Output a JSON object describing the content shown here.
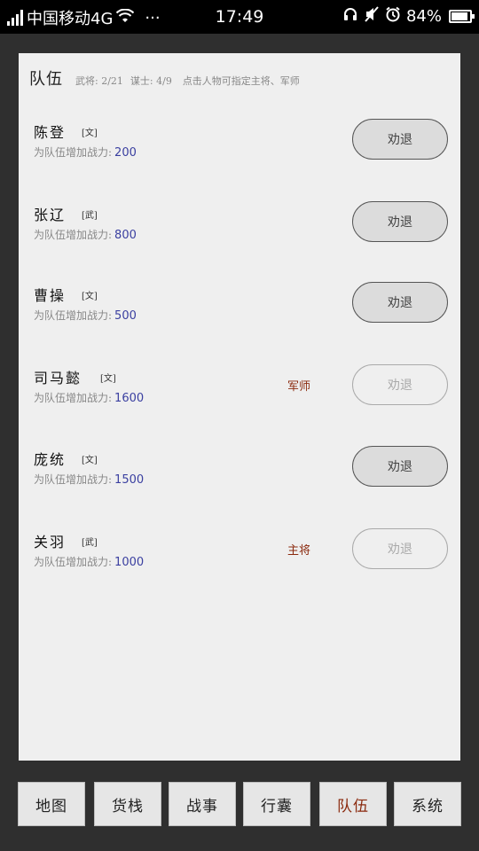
{
  "statusbar": {
    "carrier": "中国移动4G",
    "more": "···",
    "time": "17:49",
    "battery": "84%",
    "battery_level": 0.84
  },
  "panel": {
    "title": "队伍",
    "generals": "武将: 2/21",
    "advisors": "谋士: 4/9",
    "hint": "点击人物可指定主将、军师"
  },
  "power_label": "为队伍增加战力:",
  "dismiss_label": "劝退",
  "members": [
    {
      "name": "陈登",
      "type": "[文]",
      "power": "200",
      "role": ""
    },
    {
      "name": "张辽",
      "type": "[武]",
      "power": "800",
      "role": ""
    },
    {
      "name": "曹操",
      "type": "[文]",
      "power": "500",
      "role": ""
    },
    {
      "name": "司马懿",
      "type": "[文]",
      "power": "1600",
      "role": "军师"
    },
    {
      "name": "庞统",
      "type": "[文]",
      "power": "1500",
      "role": ""
    },
    {
      "name": "关羽",
      "type": "[武]",
      "power": "1000",
      "role": "主将"
    }
  ],
  "nav": {
    "items": [
      "地图",
      "货栈",
      "战事",
      "行囊",
      "队伍",
      "系统"
    ],
    "active": "队伍"
  }
}
